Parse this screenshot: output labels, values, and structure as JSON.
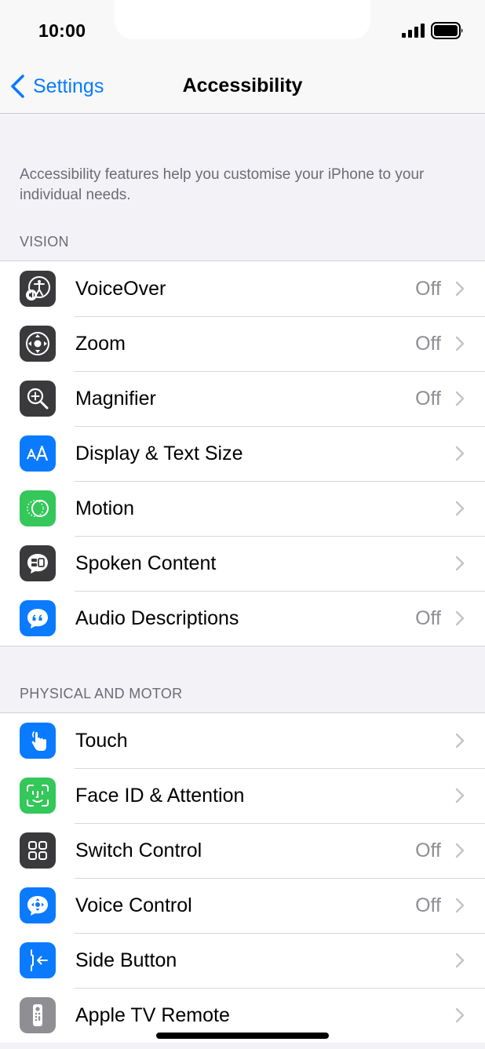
{
  "status_bar": {
    "time": "10:00"
  },
  "nav": {
    "back_label": "Settings",
    "title": "Accessibility"
  },
  "intro_text": "Accessibility features help you customise your iPhone to your individual needs.",
  "sections": [
    {
      "header": "VISION",
      "rows": [
        {
          "label": "VoiceOver",
          "value": "Off",
          "icon": "voiceover-icon",
          "color": "#3a3a3c"
        },
        {
          "label": "Zoom",
          "value": "Off",
          "icon": "zoom-icon",
          "color": "#3a3a3c"
        },
        {
          "label": "Magnifier",
          "value": "Off",
          "icon": "magnifier-icon",
          "color": "#3a3a3c"
        },
        {
          "label": "Display & Text Size",
          "value": "",
          "icon": "text-size-icon",
          "color": "#0a7aff"
        },
        {
          "label": "Motion",
          "value": "",
          "icon": "motion-icon",
          "color": "#34c759"
        },
        {
          "label": "Spoken Content",
          "value": "",
          "icon": "spoken-content-icon",
          "color": "#3a3a3c"
        },
        {
          "label": "Audio Descriptions",
          "value": "Off",
          "icon": "audio-descriptions-icon",
          "color": "#0a7aff"
        }
      ]
    },
    {
      "header": "PHYSICAL AND MOTOR",
      "rows": [
        {
          "label": "Touch",
          "value": "",
          "icon": "touch-icon",
          "color": "#0a7aff"
        },
        {
          "label": "Face ID & Attention",
          "value": "",
          "icon": "face-id-icon",
          "color": "#34c759"
        },
        {
          "label": "Switch Control",
          "value": "Off",
          "icon": "switch-control-icon",
          "color": "#3a3a3c"
        },
        {
          "label": "Voice Control",
          "value": "Off",
          "icon": "voice-control-icon",
          "color": "#0a7aff"
        },
        {
          "label": "Side Button",
          "value": "",
          "icon": "side-button-icon",
          "color": "#0a7aff"
        },
        {
          "label": "Apple TV Remote",
          "value": "",
          "icon": "apple-tv-remote-icon",
          "color": "#8e8e93"
        }
      ]
    }
  ]
}
